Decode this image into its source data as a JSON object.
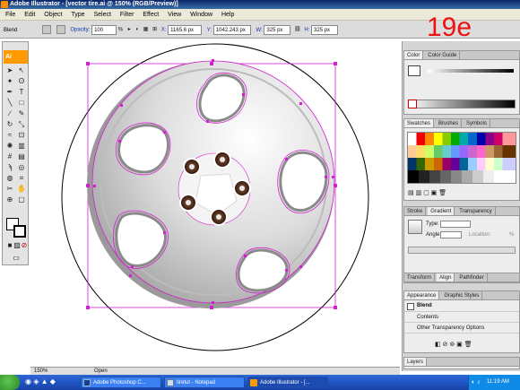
{
  "window": {
    "title": "Adobe Illustrator - [vector tire.ai @ 150% (RGB/Preview)]"
  },
  "menus": [
    "File",
    "Edit",
    "Object",
    "Type",
    "Select",
    "Filter",
    "Effect",
    "View",
    "Window",
    "Help"
  ],
  "control_bar": {
    "selection": "Blend",
    "opacity_label": "Opacity:",
    "opacity_value": "100",
    "opacity_unit": "%",
    "x_label": "X:",
    "x_value": "1165.6 px",
    "y_label": "Y:",
    "y_value": "1042.243 px",
    "w_label": "W:",
    "w_value": "325 px",
    "h_label": "H:",
    "h_value": "325 px"
  },
  "toolbox": {
    "logo": "Ai"
  },
  "overlay_label": "19e",
  "panels": {
    "color": {
      "tabs": [
        "Color",
        "Color Guide"
      ]
    },
    "swatches": {
      "tabs": [
        "Swatches",
        "Brushes",
        "Symbols"
      ]
    },
    "stroke": {
      "tabs": [
        "Stroke",
        "Gradient",
        "Transparency"
      ],
      "type_label": "Type:",
      "angle_label": "Angle:",
      "location_label": "Location:",
      "location_unit": "%"
    },
    "align": {
      "tabs": [
        "Transform",
        "Align",
        "Pathfinder"
      ]
    },
    "appearance": {
      "tabs": [
        "Appearance",
        "Graphic Styles"
      ],
      "title": "Blend",
      "rows": [
        "Contents",
        "Other Transparency Options"
      ]
    },
    "layers": {
      "tabs": [
        "Layers"
      ]
    }
  },
  "status_bar": {
    "zoom": "150%",
    "status": "Open"
  },
  "taskbar": {
    "items": [
      "Adobe Photoshop C...",
      "tiretut - Notepad",
      "Adobe Illustrator - [..."
    ],
    "clock": "11:19 AM"
  },
  "colors": {
    "selection": "#d020d0",
    "ai_orange": "#ff9a00",
    "label_red": "#ee1111"
  }
}
